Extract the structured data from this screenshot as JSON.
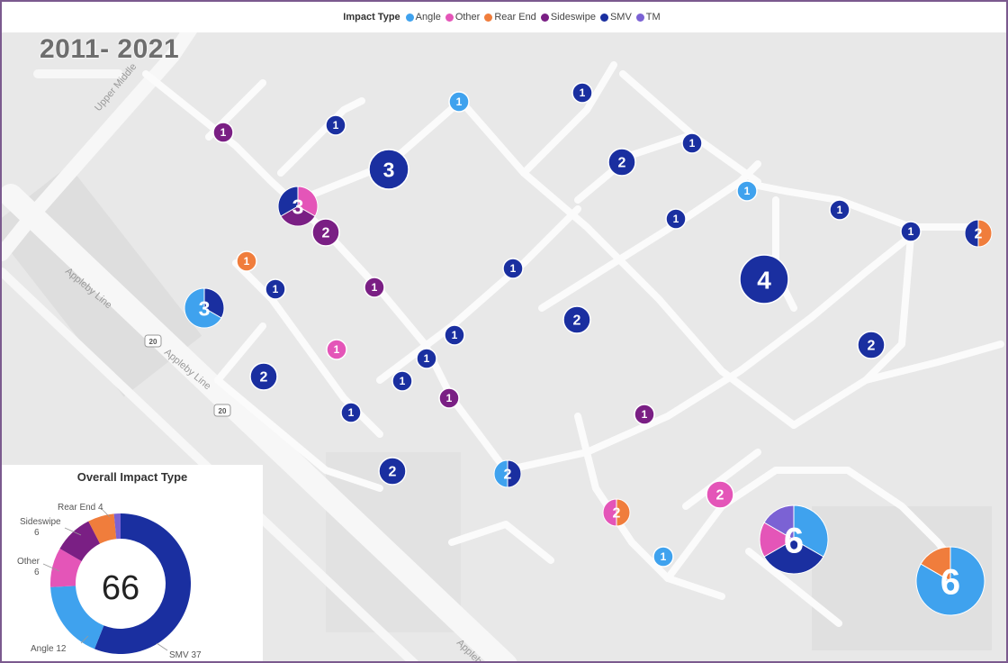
{
  "legend": {
    "title": "Impact Type",
    "items": [
      {
        "label": "Angle",
        "color": "#3fa2ee"
      },
      {
        "label": "Other",
        "color": "#e455b8"
      },
      {
        "label": "Rear End",
        "color": "#f07d3c"
      },
      {
        "label": "Sideswipe",
        "color": "#7a1f84"
      },
      {
        "label": "SMV",
        "color": "#1a2fa0"
      },
      {
        "label": "TM",
        "color": "#7b62d4"
      }
    ]
  },
  "period_label": "2011- 2021",
  "map_labels": {
    "upper_middle": "Upper Middle",
    "appleby_line": "Appleby Line",
    "appleby_line_2": "Appleby Line",
    "route_20a": "20",
    "route_20b": "20",
    "appleby_bottom": "Appleby"
  },
  "markers": [
    {
      "count": "1",
      "slices": [
        {
          "type": "Sideswipe",
          "value": 1
        }
      ]
    },
    {
      "count": "1",
      "slices": [
        {
          "type": "SMV",
          "value": 1
        }
      ]
    },
    {
      "count": "1",
      "slices": [
        {
          "type": "Angle",
          "value": 1
        }
      ]
    },
    {
      "count": "1",
      "slices": [
        {
          "type": "SMV",
          "value": 1
        }
      ]
    },
    {
      "count": "3",
      "slices": [
        {
          "type": "SMV",
          "value": 3
        }
      ]
    },
    {
      "count": "2",
      "slices": [
        {
          "type": "SMV",
          "value": 2
        }
      ]
    },
    {
      "count": "1",
      "slices": [
        {
          "type": "SMV",
          "value": 1
        }
      ]
    },
    {
      "count": "3",
      "slices": [
        {
          "type": "Other",
          "value": 1
        },
        {
          "type": "Sideswipe",
          "value": 1
        },
        {
          "type": "SMV",
          "value": 1
        }
      ]
    },
    {
      "count": "2",
      "slices": [
        {
          "type": "Sideswipe",
          "value": 2
        }
      ]
    },
    {
      "count": "1",
      "slices": [
        {
          "type": "Angle",
          "value": 1
        }
      ]
    },
    {
      "count": "1",
      "slices": [
        {
          "type": "SMV",
          "value": 1
        }
      ]
    },
    {
      "count": "1",
      "slices": [
        {
          "type": "SMV",
          "value": 1
        }
      ]
    },
    {
      "count": "1",
      "slices": [
        {
          "type": "SMV",
          "value": 1
        }
      ]
    },
    {
      "count": "2",
      "slices": [
        {
          "type": "Rear End",
          "value": 1
        },
        {
          "type": "SMV",
          "value": 1
        }
      ]
    },
    {
      "count": "1",
      "slices": [
        {
          "type": "Rear End",
          "value": 1
        }
      ]
    },
    {
      "count": "1",
      "slices": [
        {
          "type": "SMV",
          "value": 1
        }
      ]
    },
    {
      "count": "1",
      "slices": [
        {
          "type": "Sideswipe",
          "value": 1
        }
      ]
    },
    {
      "count": "3",
      "slices": [
        {
          "type": "SMV",
          "value": 1
        },
        {
          "type": "Angle",
          "value": 2
        }
      ]
    },
    {
      "count": "1",
      "slices": [
        {
          "type": "SMV",
          "value": 1
        }
      ]
    },
    {
      "count": "4",
      "slices": [
        {
          "type": "SMV",
          "value": 4
        }
      ]
    },
    {
      "count": "2",
      "slices": [
        {
          "type": "SMV",
          "value": 2
        }
      ]
    },
    {
      "count": "1",
      "slices": [
        {
          "type": "SMV",
          "value": 1
        }
      ]
    },
    {
      "count": "1",
      "slices": [
        {
          "type": "Other",
          "value": 1
        }
      ]
    },
    {
      "count": "1",
      "slices": [
        {
          "type": "SMV",
          "value": 1
        }
      ]
    },
    {
      "count": "1",
      "slices": [
        {
          "type": "SMV",
          "value": 1
        }
      ]
    },
    {
      "count": "2",
      "slices": [
        {
          "type": "SMV",
          "value": 2
        }
      ]
    },
    {
      "count": "2",
      "slices": [
        {
          "type": "SMV",
          "value": 2
        }
      ]
    },
    {
      "count": "1",
      "slices": [
        {
          "type": "SMV",
          "value": 1
        }
      ]
    },
    {
      "count": "1",
      "slices": [
        {
          "type": "Sideswipe",
          "value": 1
        }
      ]
    },
    {
      "count": "1",
      "slices": [
        {
          "type": "SMV",
          "value": 1
        }
      ]
    },
    {
      "count": "1",
      "slices": [
        {
          "type": "Sideswipe",
          "value": 1
        }
      ]
    },
    {
      "count": "2",
      "slices": [
        {
          "type": "SMV",
          "value": 2
        }
      ]
    },
    {
      "count": "2",
      "slices": [
        {
          "type": "SMV",
          "value": 1
        },
        {
          "type": "Angle",
          "value": 1
        }
      ]
    },
    {
      "count": "2",
      "slices": [
        {
          "type": "Other",
          "value": 2
        }
      ]
    },
    {
      "count": "2",
      "slices": [
        {
          "type": "Rear End",
          "value": 1
        },
        {
          "type": "Other",
          "value": 1
        }
      ]
    },
    {
      "count": "6",
      "slices": [
        {
          "type": "Angle",
          "value": 2
        },
        {
          "type": "SMV",
          "value": 2
        },
        {
          "type": "Other",
          "value": 1
        },
        {
          "type": "TM",
          "value": 1
        }
      ]
    },
    {
      "count": "1",
      "slices": [
        {
          "type": "Angle",
          "value": 1
        }
      ]
    },
    {
      "count": "6",
      "slices": [
        {
          "type": "Angle",
          "value": 5
        },
        {
          "type": "Rear End",
          "value": 1
        }
      ]
    }
  ],
  "donut": {
    "title": "Overall Impact Type",
    "total": "66",
    "labels": {
      "rear_end": "Rear End 4",
      "sideswipe_name": "Sideswipe",
      "sideswipe_value": "6",
      "other_name": "Other",
      "other_value": "6",
      "angle": "Angle 12",
      "smv": "SMV 37"
    }
  },
  "chart_data": {
    "type": "pie",
    "title": "Overall Impact Type",
    "center_label": "66",
    "categories": [
      "SMV",
      "Angle",
      "Other",
      "Sideswipe",
      "Rear End",
      "TM"
    ],
    "values": [
      37,
      12,
      6,
      6,
      4,
      1
    ],
    "colors": [
      "#1a2fa0",
      "#3fa2ee",
      "#e455b8",
      "#7a1f84",
      "#f07d3c",
      "#7b62d4"
    ]
  }
}
